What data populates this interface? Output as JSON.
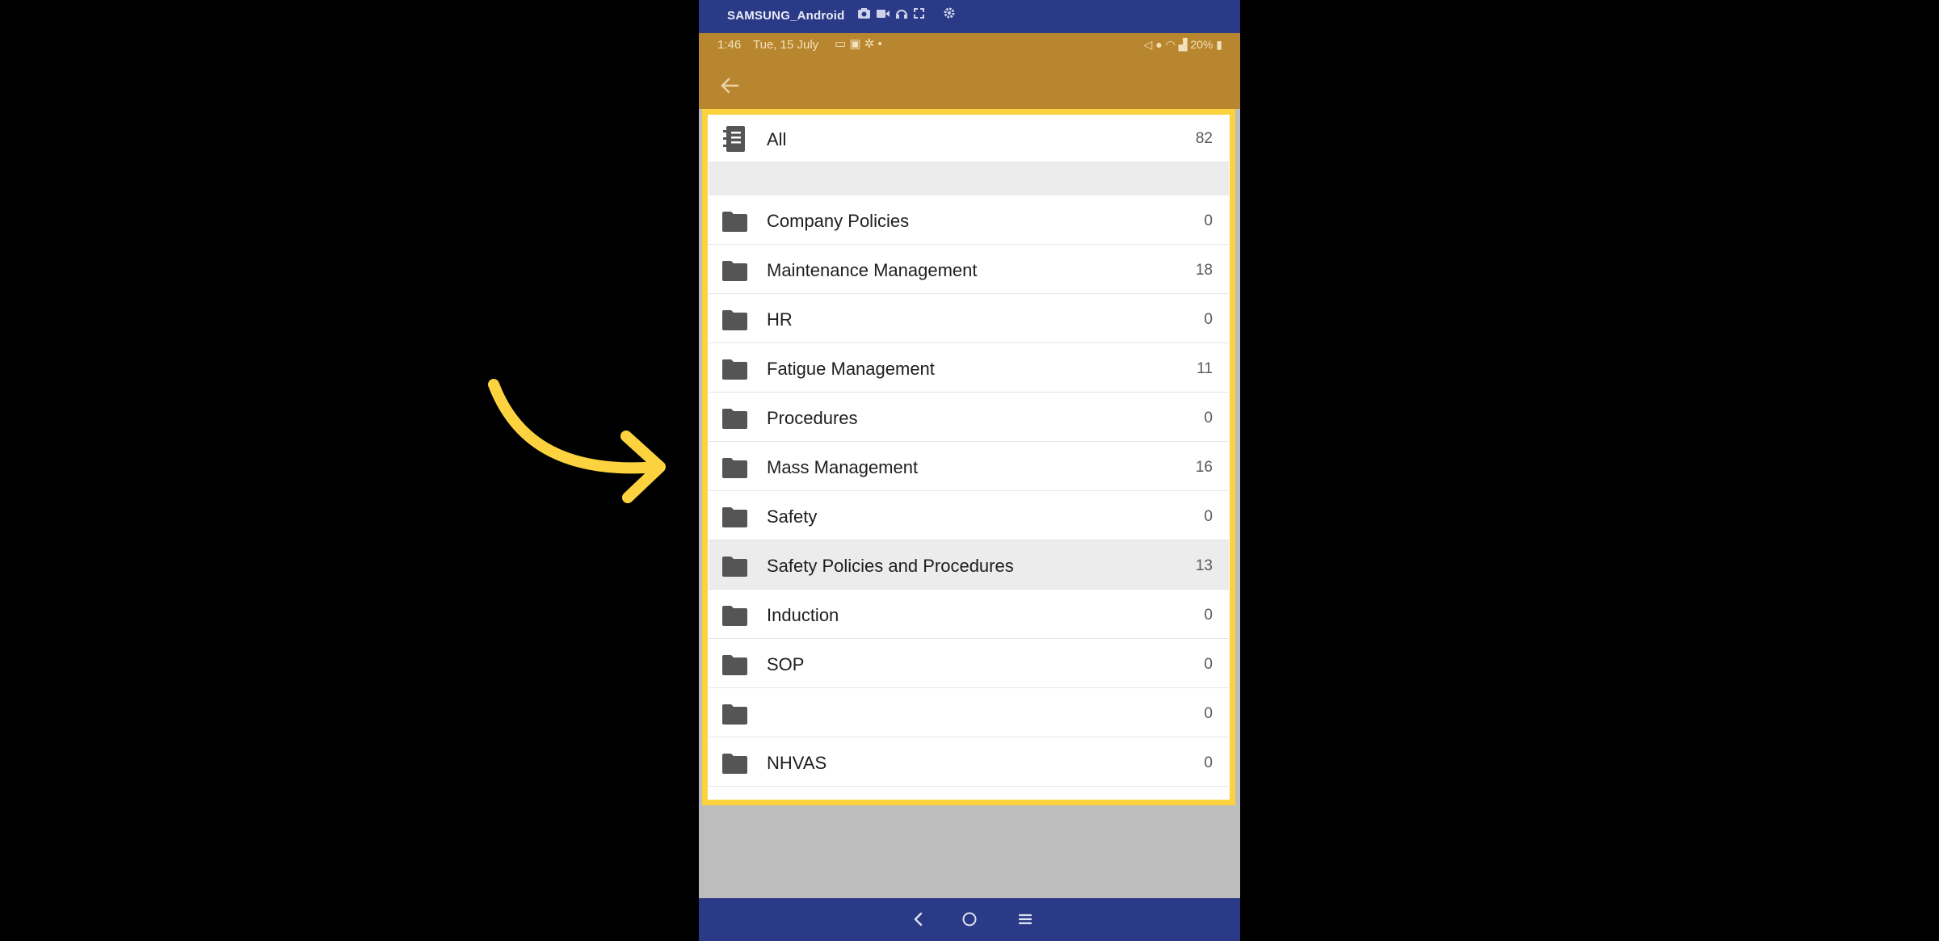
{
  "device": {
    "name": "SAMSUNG_Android",
    "icons": [
      "camera-icon",
      "video-icon",
      "headphones-icon",
      "fullscreen-icon",
      "settings-icon"
    ]
  },
  "status_bar": {
    "time": "1:46",
    "date": "Tue, 15 July",
    "notification_icons": [
      "message-icon",
      "image-icon",
      "accessibility-icon",
      "dot-icon"
    ],
    "right_text": "20%",
    "right_icons": [
      "mute-icon",
      "location-icon",
      "wifi-icon",
      "signal-icon",
      "battery-icon"
    ]
  },
  "app_bar": {
    "back_icon": "back-arrow-icon"
  },
  "all_item": {
    "label": "All",
    "count": "82",
    "icon": "notebook-icon"
  },
  "folders": [
    {
      "label": "Company Policies",
      "count": "0"
    },
    {
      "label": "Maintenance Management",
      "count": "18"
    },
    {
      "label": "HR",
      "count": "0"
    },
    {
      "label": "Fatigue Management",
      "count": "11"
    },
    {
      "label": "Procedures",
      "count": "0"
    },
    {
      "label": "Mass Management",
      "count": "16"
    },
    {
      "label": "Safety",
      "count": "0"
    },
    {
      "label": "Safety Policies and Procedures",
      "count": "13",
      "highlighted": true
    },
    {
      "label": "Induction",
      "count": "0"
    },
    {
      "label": "SOP",
      "count": "0"
    },
    {
      "label": "",
      "count": "0"
    },
    {
      "label": "NHVAS",
      "count": "0"
    }
  ],
  "nav_bar": {
    "icons": [
      "back-nav-icon",
      "home-nav-icon",
      "recents-nav-icon"
    ]
  },
  "colors": {
    "device_bar": "#2b3a87",
    "app_bar": "#b8862f",
    "highlight": "#fcd33f",
    "folder_icon": "#555555"
  }
}
